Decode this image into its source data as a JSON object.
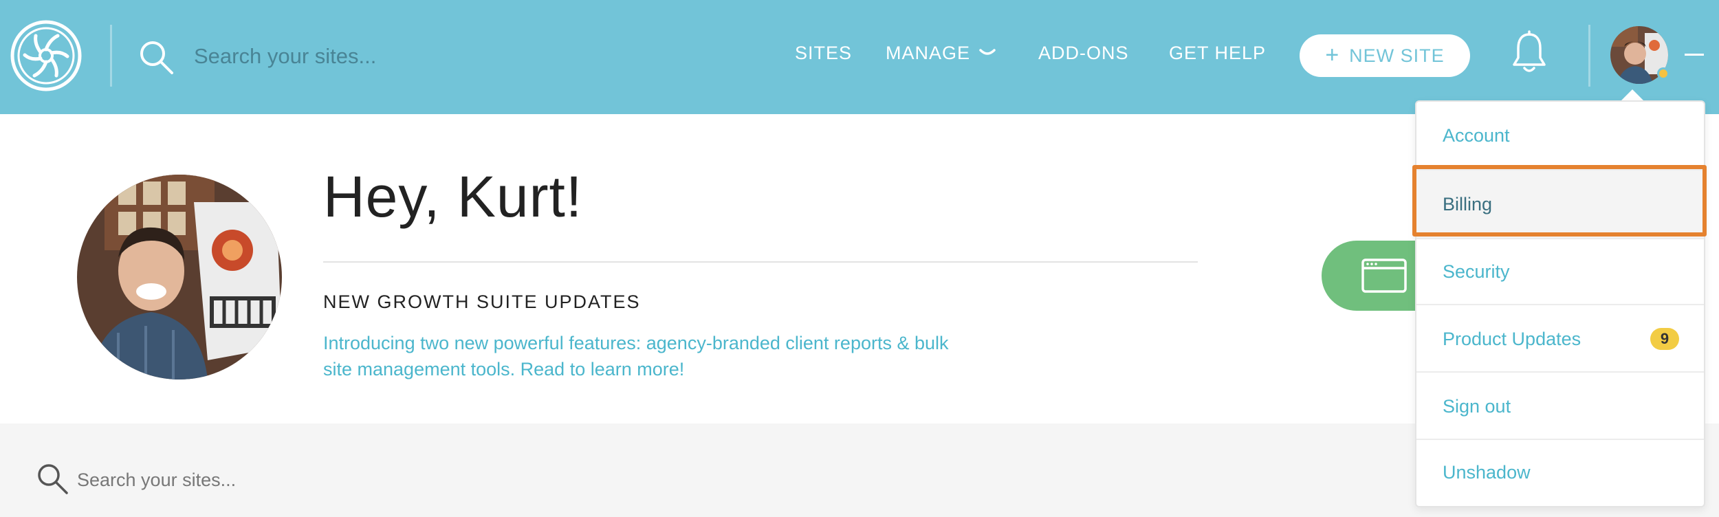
{
  "header": {
    "search_placeholder": "Search your sites...",
    "nav": {
      "sites": "SITES",
      "manage": "MANAGE",
      "addons": "ADD-ONS",
      "get_help": "GET HELP"
    },
    "new_site": {
      "plus": "+",
      "label": "NEW SITE"
    },
    "status_dot_color": "#f6c242"
  },
  "main": {
    "greeting": "Hey, Kurt!",
    "news_title": "NEW GROWTH SUITE UPDATES",
    "news_body_line1": "Introducing two new powerful features: agency-branded client reports & bulk",
    "news_body_line2": "site management tools. Read to learn more!"
  },
  "bottom": {
    "search_placeholder": "Search your sites..."
  },
  "dropdown": {
    "items": [
      {
        "label": "Account"
      },
      {
        "label": "Billing",
        "selected": true
      },
      {
        "label": "Security"
      },
      {
        "label": "Product Updates",
        "badge": "9"
      },
      {
        "label": "Sign out"
      },
      {
        "label": "Unshadow"
      }
    ]
  },
  "colors": {
    "header_bg": "#72c4d8",
    "link": "#4bb6cc",
    "green_button": "#70bf7d",
    "highlight": "#e5822f",
    "badge": "#f2cc44"
  }
}
